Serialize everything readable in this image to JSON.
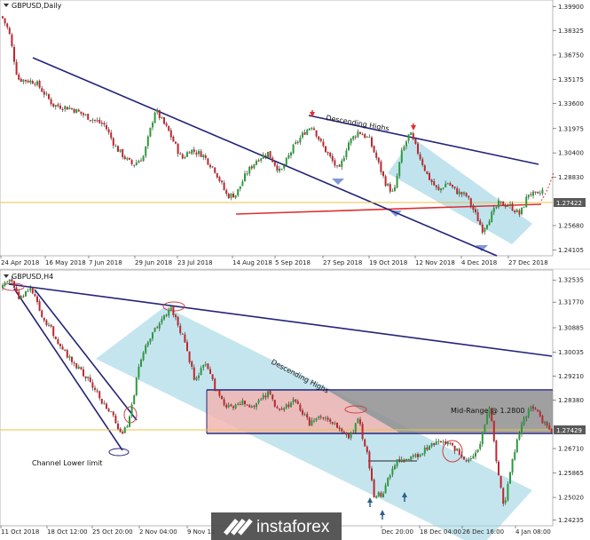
{
  "watermark": "instaforex",
  "chart_data": [
    {
      "type": "candlestick",
      "title": "GBPUSD,Daily",
      "price_tag": "1.27422",
      "y_ticks": [
        "1.39900",
        "1.38325",
        "1.36750",
        "1.35175",
        "1.33600",
        "1.31975",
        "1.30400",
        "1.28830",
        "1.27422",
        "1.25680",
        "1.24105"
      ],
      "y_tick_values": [
        1.399,
        1.38325,
        1.3675,
        1.35175,
        1.336,
        1.31975,
        1.304,
        1.2883,
        1.27422,
        1.2568,
        1.24105
      ],
      "ylim": [
        1.2372,
        1.4032
      ],
      "x_ticks": [
        "24 Apr 2018",
        "16 May 2018",
        "7 Jun 2018",
        "29 Jun 2018",
        "23 Jul 2018",
        "14 Aug 2018",
        "5 Sep 2018",
        "27 Sep 2018",
        "19 Oct 2018",
        "12 Nov 2018",
        "4 Dec 2018",
        "27 Dec 2018"
      ],
      "annotations": [
        "Descending Highs"
      ],
      "price_path": [
        [
          0,
          1.395
        ],
        [
          10,
          1.383
        ],
        [
          20,
          1.352
        ],
        [
          40,
          1.35
        ],
        [
          60,
          1.335
        ],
        [
          80,
          1.333
        ],
        [
          100,
          1.327
        ],
        [
          118,
          1.322
        ],
        [
          130,
          1.308
        ],
        [
          142,
          1.3
        ],
        [
          150,
          1.296
        ],
        [
          162,
          1.302
        ],
        [
          175,
          1.332
        ],
        [
          190,
          1.318
        ],
        [
          205,
          1.3
        ],
        [
          214,
          1.306
        ],
        [
          228,
          1.303
        ],
        [
          242,
          1.293
        ],
        [
          256,
          1.276
        ],
        [
          266,
          1.277
        ],
        [
          278,
          1.291
        ],
        [
          290,
          1.3
        ],
        [
          302,
          1.304
        ],
        [
          316,
          1.291
        ],
        [
          330,
          1.307
        ],
        [
          344,
          1.318
        ],
        [
          352,
          1.322
        ],
        [
          362,
          1.31
        ],
        [
          372,
          1.301
        ],
        [
          382,
          1.292
        ],
        [
          392,
          1.31
        ],
        [
          404,
          1.318
        ],
        [
          416,
          1.313
        ],
        [
          426,
          1.298
        ],
        [
          434,
          1.285
        ],
        [
          444,
          1.277
        ],
        [
          452,
          1.303
        ],
        [
          462,
          1.317
        ],
        [
          472,
          1.303
        ],
        [
          482,
          1.289
        ],
        [
          494,
          1.279
        ],
        [
          504,
          1.285
        ],
        [
          514,
          1.279
        ],
        [
          526,
          1.276
        ],
        [
          536,
          1.264
        ],
        [
          544,
          1.254
        ],
        [
          552,
          1.262
        ],
        [
          562,
          1.271
        ],
        [
          574,
          1.27
        ],
        [
          586,
          1.264
        ],
        [
          596,
          1.278
        ],
        [
          606,
          1.276
        ],
        [
          612,
          1.28
        ]
      ]
    },
    {
      "type": "candlestick",
      "title": "GBPUSD,H4",
      "price_tag": "1.27429",
      "y_ticks": [
        "1.32535",
        "1.31770",
        "1.30885",
        "1.30035",
        "1.29210",
        "1.28380",
        "1.27429",
        "1.26710",
        "1.25865",
        "1.25020",
        "1.24235"
      ],
      "y_tick_values": [
        1.32535,
        1.3177,
        1.30885,
        1.30035,
        1.2921,
        1.2838,
        1.27429,
        1.2671,
        1.25865,
        1.2502,
        1.24235
      ],
      "ylim": [
        1.2404,
        1.3288
      ],
      "x_ticks": [
        "11 Oct 2018",
        "18 Oct 12:00",
        "25 Oct 20:00",
        "2 Nov 04:00",
        "9 Nov 12",
        "Dec 20:00",
        "18 Dec 04:00",
        "26 Dec 16:00",
        "4 Jan 08:00"
      ],
      "annotations": [
        "Descending Highs",
        "Mid-Range @ 1.2800",
        "Channel Lower limit"
      ],
      "price_path": [
        [
          0,
          1.322
        ],
        [
          12,
          1.326
        ],
        [
          22,
          1.319
        ],
        [
          34,
          1.323
        ],
        [
          46,
          1.314
        ],
        [
          60,
          1.307
        ],
        [
          74,
          1.3
        ],
        [
          88,
          1.295
        ],
        [
          102,
          1.29
        ],
        [
          116,
          1.283
        ],
        [
          130,
          1.277
        ],
        [
          138,
          1.271
        ],
        [
          148,
          1.28
        ],
        [
          156,
          1.296
        ],
        [
          168,
          1.305
        ],
        [
          180,
          1.31
        ],
        [
          192,
          1.316
        ],
        [
          200,
          1.311
        ],
        [
          210,
          1.302
        ],
        [
          220,
          1.29
        ],
        [
          232,
          1.297
        ],
        [
          244,
          1.287
        ],
        [
          256,
          1.281
        ],
        [
          270,
          1.283
        ],
        [
          286,
          1.282
        ],
        [
          302,
          1.286
        ],
        [
          316,
          1.28
        ],
        [
          332,
          1.284
        ],
        [
          348,
          1.276
        ],
        [
          362,
          1.278
        ],
        [
          378,
          1.275
        ],
        [
          394,
          1.271
        ],
        [
          404,
          1.277
        ],
        [
          414,
          1.265
        ],
        [
          422,
          1.25
        ],
        [
          432,
          1.252
        ],
        [
          444,
          1.262
        ],
        [
          456,
          1.263
        ],
        [
          470,
          1.265
        ],
        [
          486,
          1.268
        ],
        [
          500,
          1.27
        ],
        [
          514,
          1.267
        ],
        [
          528,
          1.263
        ],
        [
          540,
          1.268
        ],
        [
          552,
          1.282
        ],
        [
          560,
          1.262
        ],
        [
          568,
          1.246
        ],
        [
          578,
          1.264
        ],
        [
          588,
          1.276
        ],
        [
          600,
          1.282
        ],
        [
          612,
          1.276
        ],
        [
          622,
          1.273
        ]
      ]
    }
  ]
}
